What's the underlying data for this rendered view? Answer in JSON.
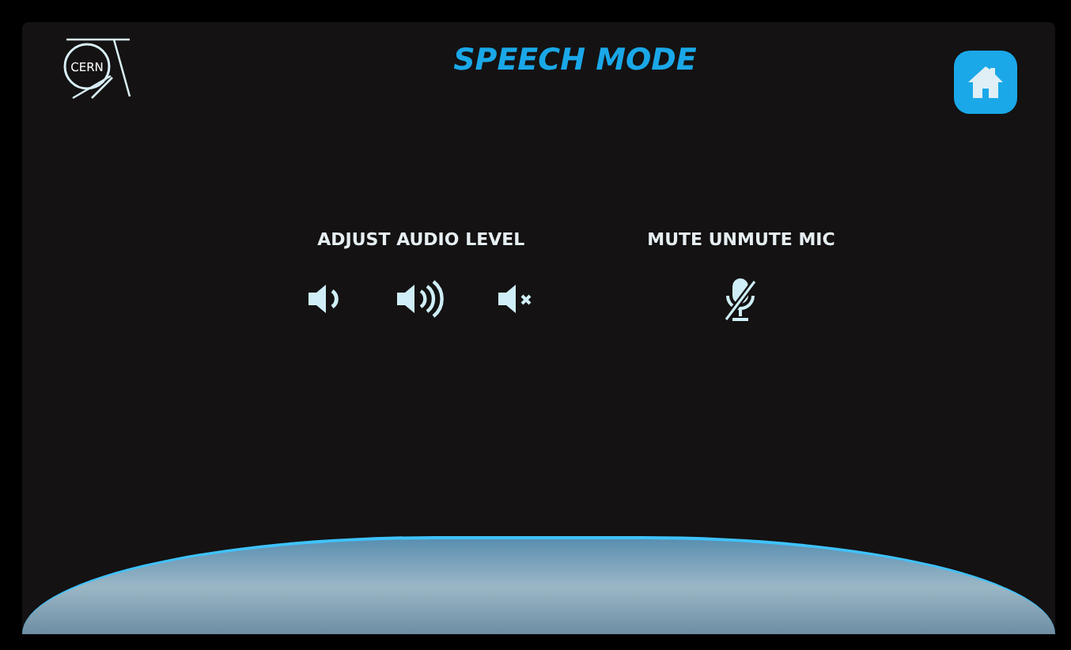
{
  "header": {
    "logo_text": "CERN",
    "title": "SPEECH MODE"
  },
  "audio": {
    "label": "ADJUST AUDIO LEVEL",
    "buttons": [
      {
        "kind": "volume-down"
      },
      {
        "kind": "volume-up"
      },
      {
        "kind": "mute"
      }
    ]
  },
  "mic": {
    "label": "MUTE UNMUTE MIC",
    "muted": true
  }
}
